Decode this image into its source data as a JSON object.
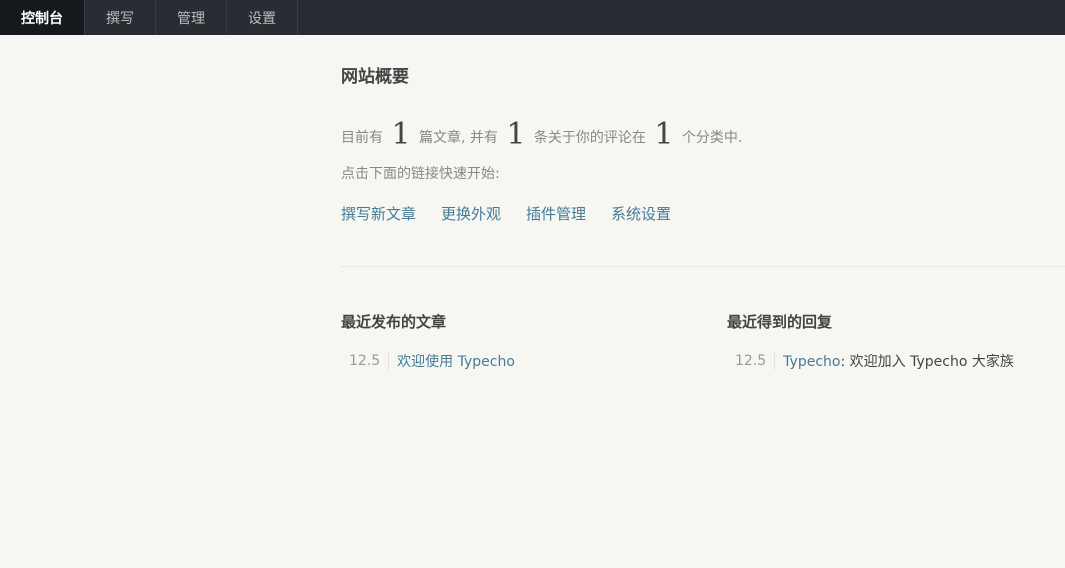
{
  "nav": {
    "items": [
      {
        "label": "控制台",
        "active": true
      },
      {
        "label": "撰写",
        "active": false
      },
      {
        "label": "管理",
        "active": false
      },
      {
        "label": "设置",
        "active": false
      }
    ]
  },
  "overview": {
    "title": "网站概要",
    "stats": {
      "prefix": "目前有",
      "posts_count": "1",
      "posts_text": "篇文章, 并有",
      "comments_count": "1",
      "comments_text": "条关于你的评论在",
      "categories_count": "1",
      "categories_text": "个分类中."
    },
    "hint": "点击下面的链接快速开始:",
    "quick_links": [
      "撰写新文章",
      "更换外观",
      "插件管理",
      "系统设置"
    ]
  },
  "recent_posts": {
    "title": "最近发布的文章",
    "items": [
      {
        "date": "12.5",
        "title": "欢迎使用 Typecho"
      }
    ]
  },
  "recent_replies": {
    "title": "最近得到的回复",
    "items": [
      {
        "date": "12.5",
        "author": "Typecho",
        "separator": ": ",
        "text": "欢迎加入 Typecho 大家族"
      }
    ]
  },
  "colors": {
    "topbar_bg": "#292d33",
    "active_tab_bg": "#16191c",
    "page_bg": "#f6f6f3",
    "link": "#467b96"
  }
}
